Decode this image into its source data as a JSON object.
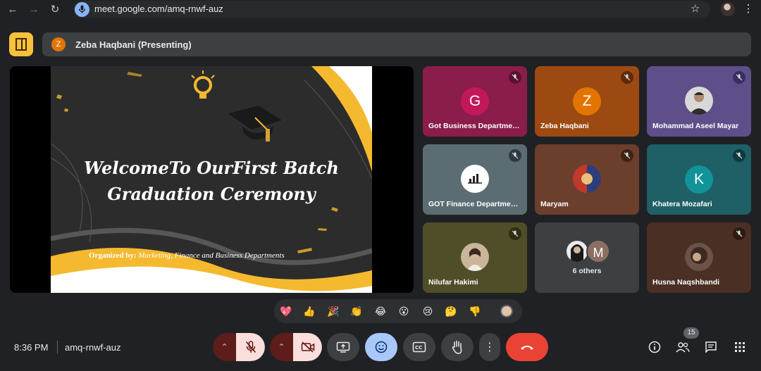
{
  "browser": {
    "url": "meet.google.com/amq-rnwf-auz",
    "icons": [
      "back-icon",
      "forward-icon",
      "reload-icon",
      "mic-icon",
      "star-icon",
      "profile-avatar",
      "menu-icon"
    ]
  },
  "presenting": {
    "avatar_initial": "Z",
    "label": "Zeba Haqbani (Presenting)"
  },
  "slide": {
    "title_line1": "WelcomeTo OurFirst Batch",
    "title_line2": "Graduation Ceremony",
    "organized_by_label": "Organized by:",
    "organized_by_value": "Marketing, Finance and Business Departments"
  },
  "tiles": [
    {
      "name": "Got Business Departme…",
      "initial": "G",
      "bg": "#8a1d4a",
      "avatar_bg": "#c2185b",
      "muted": true
    },
    {
      "name": "Zeba Haqbani",
      "initial": "Z",
      "bg": "#9c4a12",
      "avatar_bg": "#e37400",
      "muted": true
    },
    {
      "name": "Mohammad Aseel Mayar",
      "initial": "",
      "bg": "#5e4e8a",
      "avatar_bg": "#d8d8d8",
      "muted": true
    },
    {
      "name": "GOT Finance Departme…",
      "initial": "",
      "bg": "#5b6d73",
      "avatar_bg": "#ffffff",
      "muted": true
    },
    {
      "name": "Maryam",
      "initial": "",
      "bg": "#6b3f2c",
      "avatar_bg": "#b34a2a",
      "muted": true
    },
    {
      "name": "Khatera Mozafari",
      "initial": "K",
      "bg": "#1f5f66",
      "avatar_bg": "#12939a",
      "muted": true
    },
    {
      "name": "Nilufar Hakimi",
      "initial": "",
      "bg": "#4f4e28",
      "avatar_bg": "#c9b59a",
      "muted": true
    },
    {
      "name": "6 others",
      "initial": "M",
      "bg": "#3c4043",
      "avatar_bg": "#8d6e63",
      "muted": false
    },
    {
      "name": "Husna Naqshbandi",
      "initial": "",
      "bg": "#4a2f24",
      "avatar_bg": "#6d5247",
      "muted": true
    }
  ],
  "reactions": [
    "💖",
    "👍",
    "🎉",
    "👏",
    "😂",
    "😮",
    "😢",
    "🤔",
    "👎"
  ],
  "bottom": {
    "time": "8:36 PM",
    "meeting_code": "amq-rnwf-auz",
    "participant_count": "15"
  },
  "colors": {
    "mute_active": "#f9dedc",
    "mute_arrow": "#5c1d1b",
    "end_call": "#ea4335",
    "emoji_active": "#a8c7fa"
  }
}
